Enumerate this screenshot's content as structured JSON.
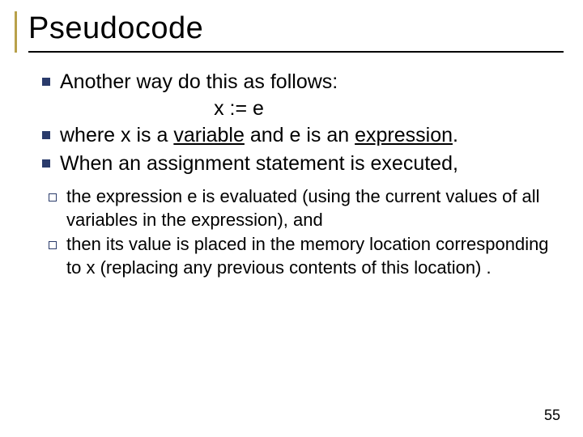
{
  "title": "Pseudocode",
  "bullets": {
    "b1": "Another way do this as follows:",
    "formula": "x := e",
    "b2_pre": "where ",
    "b2_x": "x",
    "b2_mid1": " is a ",
    "b2_var": "variable",
    "b2_mid2": " and ",
    "b2_e": "e",
    "b2_mid3": " is an ",
    "b2_expr": "expression",
    "b2_end": ".",
    "b3": "When an assignment statement is executed,"
  },
  "sub": {
    "s1": " the expression e is evaluated (using the current values of all variables in the expression), and",
    "s2": "then its value is placed in the memory location corresponding to x (replacing any previous contents of this location) ."
  },
  "pageno": "55"
}
